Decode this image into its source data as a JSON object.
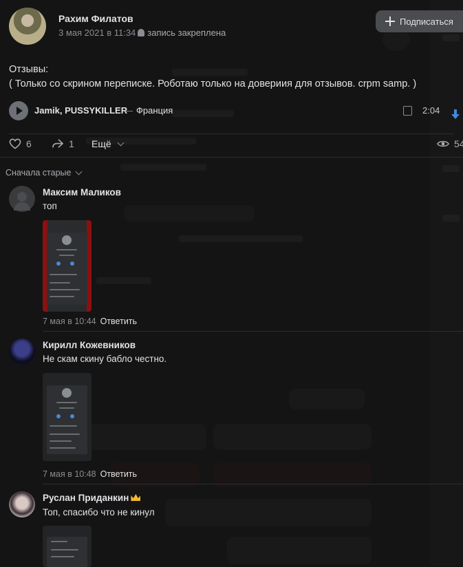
{
  "post": {
    "author": "Рахим Филатов",
    "date": "3 мая 2021 в 11:34",
    "pinned_label": "запись закреплена",
    "subscribe_label": "Подписаться",
    "text_line1": "Отзывы:",
    "text_line2": "( Только со скрином переписке. Роботаю только на довериия для отзывов. crpm samp. )",
    "audio": {
      "artist": "Jamik, PUSSYKILLER",
      "separator": "—",
      "title": "Франция",
      "duration": "2:04"
    },
    "likes": "6",
    "shares": "1",
    "more_label": "Ещё",
    "views": "54"
  },
  "comments_sort": "Сначала старые",
  "comments": [
    {
      "name": "Максим Маликов",
      "text": "топ",
      "date": "7 мая в 10:44",
      "reply": "Ответить"
    },
    {
      "name": "Кирилл Кожевников",
      "text": "Не скам скину бабло честно.",
      "date": "7 мая в 10:48",
      "reply": "Ответить"
    },
    {
      "name": "Руслан Приданкин",
      "text": "Топ, спасибо что не кинул",
      "date": "",
      "reply": ""
    }
  ],
  "colors": {
    "background": "#141414",
    "text": "#e1e3e6",
    "secondary": "#8a8d91",
    "accent": "#3f8ae0",
    "button": "#4b4c4f"
  },
  "icons": [
    "android-icon",
    "plus-icon",
    "play-icon",
    "lyrics-icon",
    "download-icon",
    "heart-icon",
    "share-icon",
    "eye-icon",
    "chevron-down-icon",
    "crown-icon",
    "rainbow-flag-icon"
  ]
}
